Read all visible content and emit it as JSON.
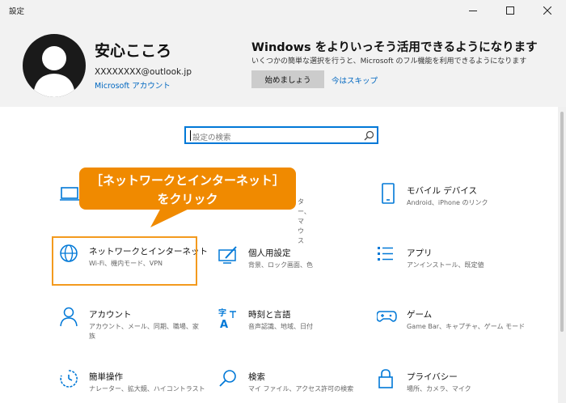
{
  "window": {
    "title": "設定"
  },
  "account": {
    "name": "安心こころ",
    "email": "XXXXXXXX@outlook.jp",
    "link": "Microsoft アカウント"
  },
  "promo": {
    "title": "Windows をよりいっそう活用できるようになります",
    "desc": "いくつかの簡単な選択を行うと、Microsoft のフル機能を利用できるようになります",
    "start_button": "始めましょう",
    "skip_link": "今はスキップ"
  },
  "search": {
    "placeholder": "設定の検索"
  },
  "callout": {
    "line1": "［ネットワークとインターネット］",
    "line2": "をクリック"
  },
  "tiles": {
    "devices": {
      "desc": "ター、マウス"
    },
    "mobile": {
      "title": "モバイル デバイス",
      "desc": "Android、iPhone のリンク"
    },
    "network": {
      "title": "ネットワークとインターネット",
      "desc": "Wi-Fi、機内モード、VPN"
    },
    "personalization": {
      "title": "個人用設定",
      "desc": "背景、ロック画面、色"
    },
    "apps": {
      "title": "アプリ",
      "desc": "アンインストール、既定値"
    },
    "accounts": {
      "title": "アカウント",
      "desc1": "アカウント、メール、同期、職場、家",
      "desc2": "族"
    },
    "time": {
      "title": "時刻と言語",
      "desc": "音声認識、地域、日付"
    },
    "gaming": {
      "title": "ゲーム",
      "desc": "Game Bar、キャプチャ、ゲーム モード"
    },
    "ease": {
      "title": "簡単操作",
      "desc": "ナレーター、拡大鏡、ハイコントラスト"
    },
    "search": {
      "title": "検索",
      "desc": "マイ ファイル、アクセス許可の検索"
    },
    "privacy": {
      "title": "プライバシー",
      "desc": "場所、カメラ、マイク"
    }
  },
  "colors": {
    "accent": "#0078d7",
    "link": "#0067c0",
    "callout": "#f08a00",
    "highlight": "#f39a1e"
  }
}
